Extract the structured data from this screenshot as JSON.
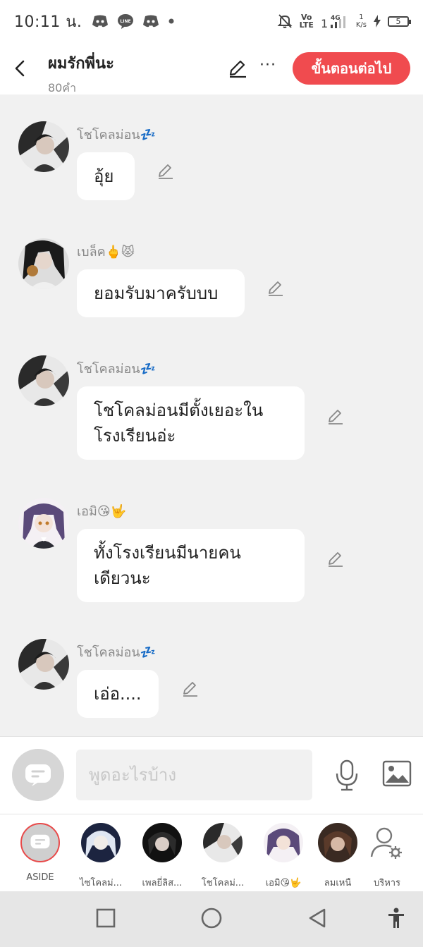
{
  "status_bar": {
    "time": "10:11 น.",
    "notification_icons": [
      "discord-icon",
      "line-icon",
      "discord-icon",
      "dot-icon"
    ],
    "volte": "Vo\nLTE",
    "network": "4G",
    "speed_top": "1",
    "speed_bottom": "K/s",
    "battery": "5"
  },
  "header": {
    "title": "ผมรักพี่นะ",
    "word_count": "80คำ",
    "more_label": "···",
    "next_button": "ขั้นตอนต่อไป"
  },
  "messages": [
    {
      "sender": "โชโคลม่อน💤",
      "text": "อุ้ย"
    },
    {
      "sender": "เบล็ค🖕😾",
      "text": "ยอมรับมาครับบบ"
    },
    {
      "sender": "โชโคลม่อน💤",
      "line1": "โชโคลม่อนมีตั้งเยอะใน",
      "line2": "โรงเรียนอ่ะ"
    },
    {
      "sender": "เอมิ😘🤟",
      "line1": "ทั้งโรงเรียนมีนายคน",
      "line2": "เดียวนะ"
    },
    {
      "sender": "โชโคลม่อน💤",
      "text": "เอ่อ...."
    }
  ],
  "composer": {
    "placeholder": "พูดอะไรบ้าง"
  },
  "characters": [
    {
      "label": "ASIDE"
    },
    {
      "label": "ไซโคลม่..."
    },
    {
      "label": "เพลยี่ลิส..."
    },
    {
      "label": "โชโคลม่..."
    },
    {
      "label": "เอมิ😘🤟"
    },
    {
      "label": "ลมเหนื"
    },
    {
      "label": "บริหาร"
    }
  ],
  "colors": {
    "accent": "#f04b4f",
    "background": "#f1f1f1",
    "bubble": "#ffffff"
  }
}
